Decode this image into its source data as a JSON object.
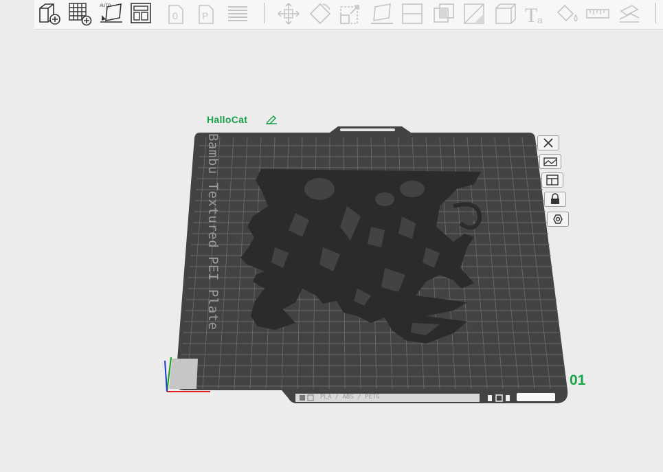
{
  "toolbar": {
    "buttons": [
      {
        "name": "add-object",
        "icon": "cube-add-icon"
      },
      {
        "name": "add-plate",
        "icon": "grid-add-icon"
      },
      {
        "name": "auto-orient",
        "icon": "auto-orient-icon",
        "label": "AUTO"
      },
      {
        "name": "arrange",
        "icon": "arrange-icon"
      },
      {
        "name": "copy",
        "icon": "copy-icon"
      },
      {
        "name": "paste",
        "icon": "paste-icon"
      },
      {
        "name": "layers",
        "icon": "layers-icon"
      },
      {
        "name": "move",
        "icon": "move-icon"
      },
      {
        "name": "rotate",
        "icon": "rotate-icon"
      },
      {
        "name": "scale",
        "icon": "scale-icon"
      },
      {
        "name": "lay-on-face",
        "icon": "lay-on-face-icon"
      },
      {
        "name": "split",
        "icon": "split-icon"
      },
      {
        "name": "boolean",
        "icon": "boolean-icon"
      },
      {
        "name": "cut",
        "icon": "cut-icon"
      },
      {
        "name": "mesh",
        "icon": "mesh-icon"
      },
      {
        "name": "text",
        "icon": "text-icon",
        "label": "Ta"
      },
      {
        "name": "paint",
        "icon": "paint-bucket-icon"
      },
      {
        "name": "measure",
        "icon": "ruler-icon"
      },
      {
        "name": "assembly",
        "icon": "assembly-icon"
      }
    ]
  },
  "plate": {
    "name": "HalloCat",
    "label": "Bambu Textured PEI Plate",
    "number": "01",
    "bottom_text": "PLA / ABS / PETG",
    "accent": "#18a34a"
  },
  "side_buttons": [
    {
      "name": "close-plate",
      "icon": "close-icon"
    },
    {
      "name": "plate-settings",
      "icon": "image-icon"
    },
    {
      "name": "arrange-plate",
      "icon": "arrange-icon"
    },
    {
      "name": "lock-plate",
      "icon": "lock-icon"
    },
    {
      "name": "plate-gear",
      "icon": "gear-icon"
    }
  ]
}
